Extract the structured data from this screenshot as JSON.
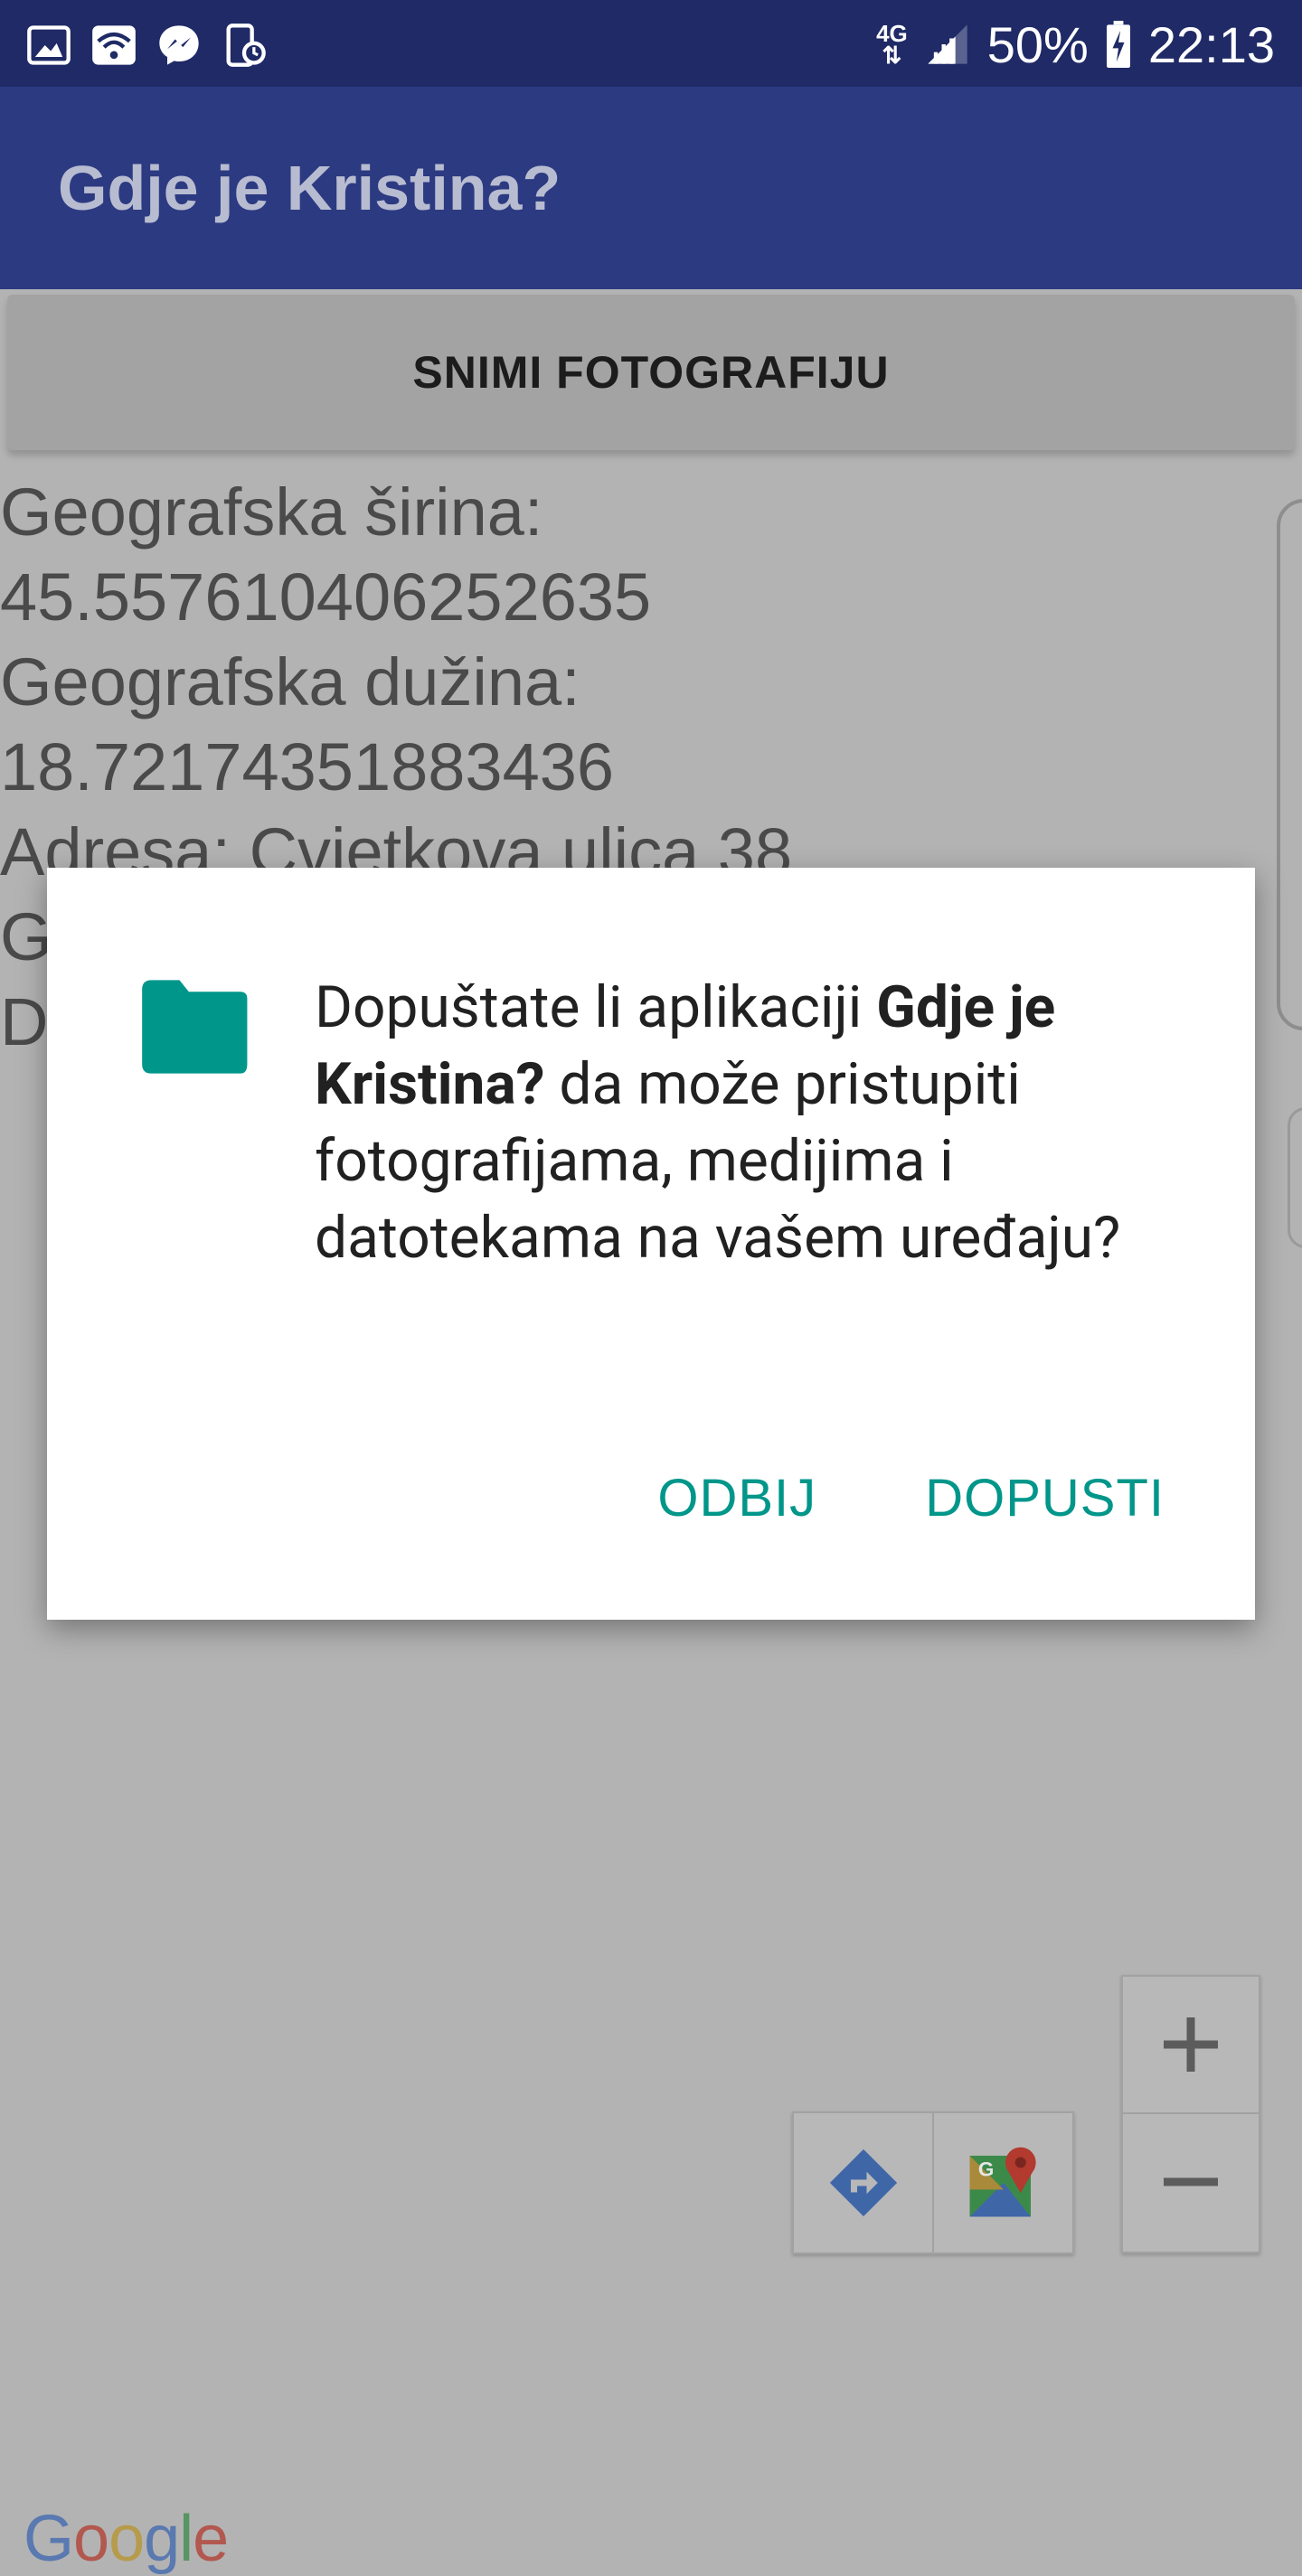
{
  "status_bar": {
    "network_label": "4G",
    "battery": "50%",
    "time": "22:13"
  },
  "app_bar": {
    "title": "Gdje je Kristina?"
  },
  "main": {
    "snap_button_label": "SNIMI FOTOGRAFIJU",
    "info_lines": [
      "Geografska širina:",
      "45.557610406252635",
      "Geografska dužina:",
      "18.72174351883436",
      "Adresa: Cvjetkova ulica 38",
      "G",
      "D"
    ]
  },
  "dialog": {
    "message_part1": "Dopuštate li aplikaciji ",
    "message_app_name": "Gdje je Kristina?",
    "message_part2": " da može pristupiti fotografijama, medijima i datotekama na vašem uređaju?",
    "deny_label": "ODBIJ",
    "allow_label": "DOPUSTI",
    "accent_color": "#00968a"
  },
  "map": {
    "google_logo": "Google"
  },
  "colors": {
    "status_bar": "#1f2a66",
    "app_bar": "#2c3a82",
    "scrim_background": "#b3b3b3",
    "accent": "#00968a"
  }
}
